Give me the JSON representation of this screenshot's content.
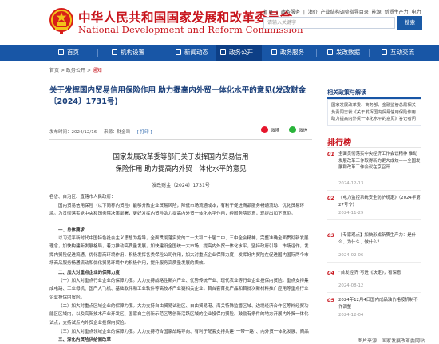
{
  "header": {
    "logo_cn": "中华人民共和国国家发展和改革委员会",
    "logo_en": "National Development and Reform Commission",
    "top_links": [
      "首页",
      "|",
      "政务服务",
      "|",
      "油价",
      "产业结构调整指导目录",
      "能源",
      "新质生产力",
      "电力"
    ],
    "search_placeholder": "请输入关键字",
    "search_button": "搜索"
  },
  "nav": {
    "items": [
      "首页",
      "机构设置",
      "新闻动态",
      "政务公开",
      "政务服务",
      "发改数据",
      "互动交流"
    ],
    "active_index": 3
  },
  "breadcrumb": {
    "items": [
      "首页",
      ">",
      "政务公开",
      ">",
      "通知"
    ]
  },
  "article": {
    "title": "关于发挥国内贸易信用保险作用 助力提高内外贸一体化水平的意见(发改财金〔2024〕1731号)",
    "publish_time": "发布时间：2024/12/16",
    "source": "来源：财金司",
    "print_label": "[ 打印 ]",
    "share_weibo": "微博",
    "share_wechat": "微信",
    "doc_title_line1": "国家发展改革委等部门关于发挥国内贸易信用",
    "doc_title_line2": "保险作用 助力提高内外贸一体化水平的意见",
    "doc_number": "发改财金〔2024〕1731号",
    "salutation": "各省、自治区、直辖市人民政府：",
    "paragraphs": [
      "国内贸易信用保险（以下简称内贸险）能够分散企业贸易风险，降低市场流通成本，有利于促进商品服务畅通流动、优化贸易环境。为贯彻落实党中央和国务院决策部署，更好发挥内贸险助力提高内外贸一体化水平作用，经国务院同意，现提出如下意见。",
      "一、总体要求",
      "以习近平新时代中国特色社会主义思想为指导，全面贯彻落实党的二十大和二十届二中、三中全会精神，完整准确全面贯彻新发展理念，加快构建新发展格局，着力推动高质量发展，加快建设全国统一大市场，提高内外贸一体化水平，坚持政府引导、市场运作，发挥内贸险促进流通、优化营商环境作用，积极发挥各类保险公司作用，加大对重点企业保障力度，发挥好内贸险在促进国内国际两个市场商品服务畅通流动和优化贸易环境中的积极作用，提升服务高质量发展的质效。",
      "二、加大对重点企业的保障力度",
      "（一）加大对重点行业企业的保障力度。大力支持战略性新兴产业、优势传统产业、现代农业等行业企业投保内贸险。重点支持集成电路、工业母机、国产大飞机、基础软件和工业软件等高技术产业链相关企业，首台套首批产品和首批次新材料推广应用等重点行业企业投保内贸险。",
      "（二）加大对重点区域企业的保障力度。大力支持自由贸易试验区、自由贸易港、海关特殊监管区域、边境经济合作区等外经贸功能区区域内，以及高新技术产业开发区、国家自主创新示范区等创新活跃区域的企业投保内贸险。鼓励有条件的地方开展内外贸一体化试点，支持试点内外贸企业投保内贸险。",
      "（三）加大对重点领域企业的保障力度。大力支持符合国家战略导向、有利于配套支持共建“一带一路”、内外贸一体化发展、商品分销体系建设等相关企业，以及“专精特新”中小企业投保内贸险。加大支持与大规模设备更新和消费品以旧换新相关企业投保内贸险。",
      "三、深化内贸险供给侧改革"
    ]
  },
  "sidebar": {
    "related_title": "相关政策与解读",
    "related_text": "国家发展改革委、商务部、金融监管总局相关负责同志就《关于发挥国内贸易信用保险作用 助力提高内外贸一体化水平的意见》答记者问",
    "ranking_title": "排行榜",
    "ranking": [
      {
        "num": "01",
        "text": "全面贯彻落实中央经济工作会议精神 推动发展改革工作取得新的更大成效——全国发展和改革工作会议在京召开",
        "date": "2024-12-13"
      },
      {
        "num": "02",
        "text": "《电力监控系统安全防护规定》（2024年第27号令）",
        "date": "2024-11-29"
      },
      {
        "num": "03",
        "text": "【专家观点】加快形成新质生产力：是什么、为什么、做什么？",
        "date": "2024-02-06"
      },
      {
        "num": "04",
        "text": "“首发经济”写进《决定》，有深意",
        "date": "2024-08-12"
      },
      {
        "num": "05",
        "text": "2024年12月4日国内成品油价格按机制不作调整",
        "date": "2024-12-04"
      }
    ]
  },
  "caption": "图片来源：国家发展改革委网站",
  "colors": {
    "brand_red": "#c8141c",
    "nav_blue": "#1856a6",
    "title_blue": "#1a3f7a"
  },
  "icons": [
    "national-emblem-icon",
    "home-icon",
    "org-icon",
    "news-icon",
    "gov-info-icon",
    "service-icon",
    "data-icon",
    "chat-icon",
    "weibo-icon",
    "wechat-icon"
  ]
}
